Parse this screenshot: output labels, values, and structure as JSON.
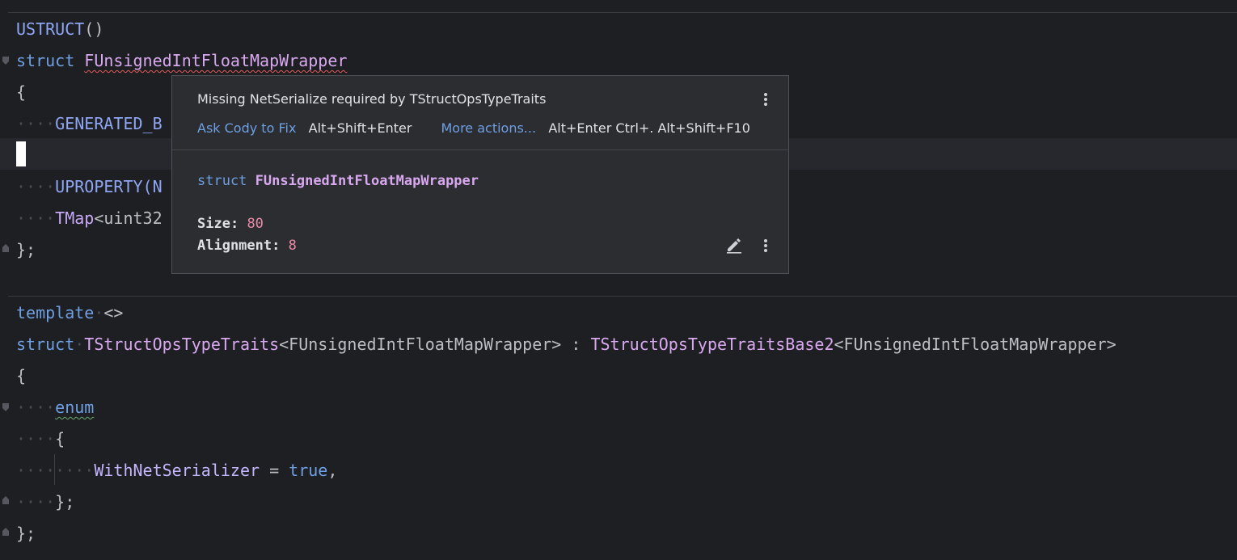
{
  "code": {
    "line1": {
      "macro": "USTRUCT",
      "punc": "()"
    },
    "line2": {
      "kw": "struct",
      "name": "FUnsignedIntFloatMapWrapper"
    },
    "line3": "{",
    "line4": {
      "ws": "····",
      "text": "GENERATED_B"
    },
    "line6": {
      "ws": "····",
      "text": "UPROPERTY(N"
    },
    "line7": {
      "ws": "····",
      "type": "TMap",
      "rest": "<uint32"
    },
    "line8": "};",
    "line10": {
      "kw": "template",
      "rest": "<>"
    },
    "line11": {
      "kw": "struct",
      "name": "TStructOpsTypeTraits",
      "arg": "<FUnsignedIntFloatMapWrapper>",
      "colon": " : ",
      "base": "TStructOpsTypeTraitsBase2",
      "arg2": "<FUnsignedIntFloatMapWrapper>"
    },
    "line12": "{",
    "line13": {
      "ws": "····",
      "kw": "enum"
    },
    "line14": {
      "ws": "····",
      "text": "{"
    },
    "line15": {
      "ws": "········",
      "ident": "WithNetSerializer",
      "eq": " = ",
      "kw": "true",
      "punc": ","
    },
    "line16": {
      "ws": "····",
      "text": "};"
    },
    "line17": "};"
  },
  "popup": {
    "message": "Missing NetSerialize required by TStructOpsTypeTraits",
    "ask_cody": "Ask Cody to Fix",
    "ask_cody_shortcut": "Alt+Shift+Enter",
    "more_actions": "More actions...",
    "more_actions_shortcut": "Alt+Enter Ctrl+. Alt+Shift+F10",
    "signature_kw": "struct",
    "signature_name": "FUnsignedIntFloatMapWrapper",
    "size_label": "Size:",
    "size_value": "80",
    "alignment_label": "Alignment:",
    "alignment_value": "8"
  },
  "icons": [
    "more-vertical-icon",
    "edit-pencil-icon",
    "fold-icon"
  ]
}
